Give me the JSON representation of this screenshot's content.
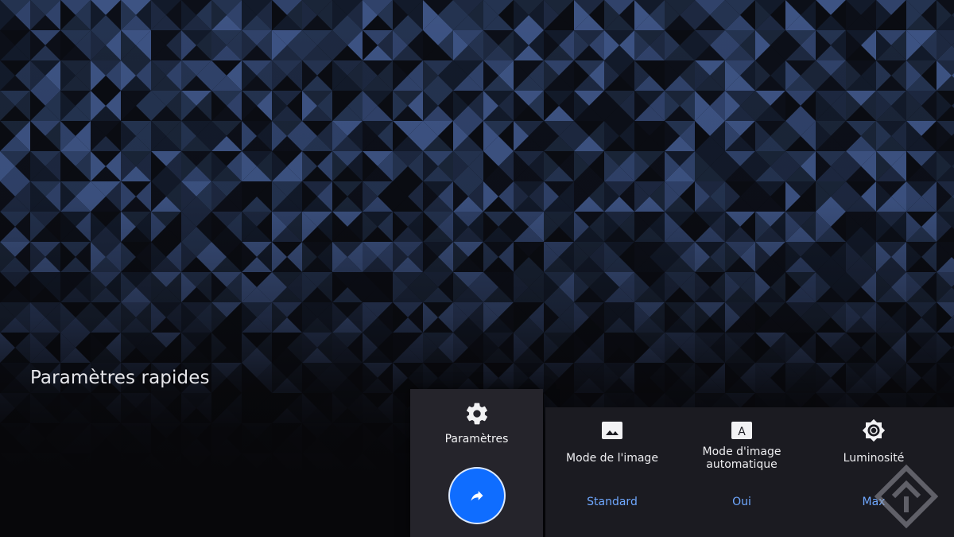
{
  "panel": {
    "title": "Paramètres rapides"
  },
  "focused": {
    "label": "Paramètres",
    "icon": "gear-icon",
    "action_icon": "arrow-forward-icon",
    "accent": "#0f6dff"
  },
  "tiles": [
    {
      "icon": "image-icon",
      "name": "Mode de l'image",
      "value": "Standard"
    },
    {
      "icon": "auto-a-icon",
      "name_line1": "Mode d'image",
      "name_line2": "automatique",
      "value": "Oui"
    },
    {
      "icon": "brightness-icon",
      "name": "Luminosité",
      "value": "Max"
    }
  ],
  "colors": {
    "value_text": "#6fa8ff",
    "card_bg": "#25242b",
    "strip_bg": "#1b1b21"
  }
}
